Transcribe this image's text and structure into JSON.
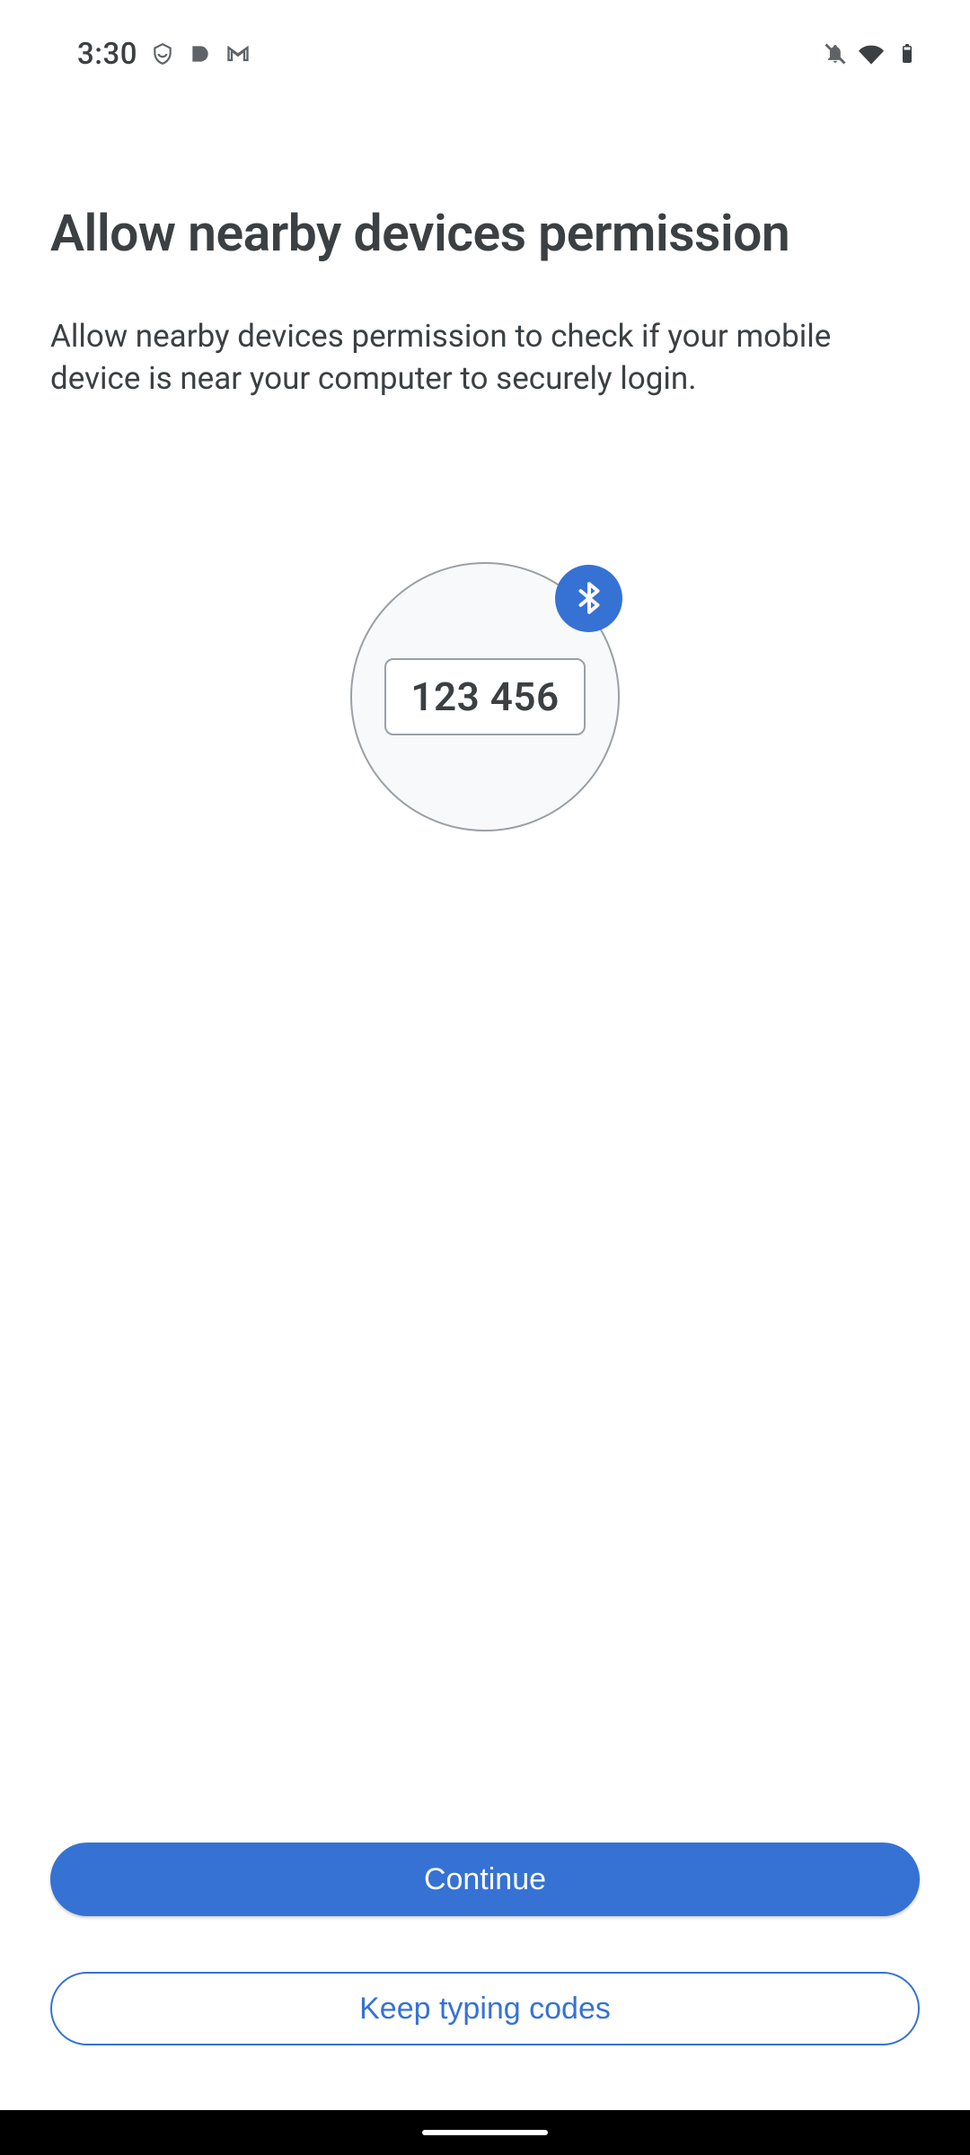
{
  "status_bar": {
    "time": "3:30"
  },
  "page": {
    "title": "Allow nearby devices permission",
    "description": "Allow nearby devices permission to check if your mobile device is near your computer to securely login."
  },
  "illustration": {
    "code": "123 456"
  },
  "buttons": {
    "primary": "Continue",
    "secondary": "Keep typing codes"
  }
}
